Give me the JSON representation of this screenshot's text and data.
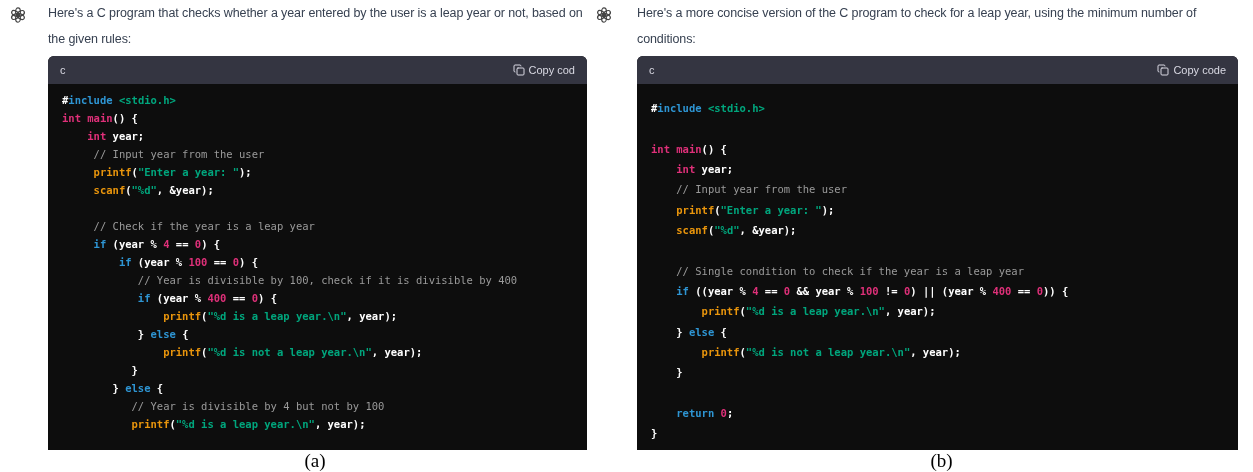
{
  "panels": [
    {
      "message": "Here's a C program that checks whether a year entered by the user is a leap year or not, based on the given rules:",
      "code_block": {
        "language": "c",
        "copy_label": "Copy cod",
        "lines": [
          {
            "kind": "code",
            "tokens": [
              {
                "kind": "plain",
                "text": "#"
              },
              {
                "kind": "keyword",
                "text": "include"
              },
              {
                "kind": "string",
                "text": " <stdio.h>"
              }
            ]
          },
          {
            "kind": "code",
            "tokens": [
              {
                "kind": "type",
                "text": "int"
              },
              {
                "kind": "type",
                "text": " main"
              },
              {
                "kind": "plain",
                "text": "() {"
              }
            ]
          },
          {
            "kind": "code",
            "tokens": [
              {
                "kind": "type",
                "text": "    int"
              },
              {
                "kind": "plain",
                "text": " year;"
              }
            ]
          },
          {
            "kind": "code",
            "tokens": [
              {
                "kind": "comment",
                "text": "     // Input year from the user"
              }
            ]
          },
          {
            "kind": "code",
            "tokens": [
              {
                "kind": "function",
                "text": "     printf"
              },
              {
                "kind": "plain",
                "text": "("
              },
              {
                "kind": "string",
                "text": "\"Enter a year: \""
              },
              {
                "kind": "plain",
                "text": ");"
              }
            ]
          },
          {
            "kind": "code",
            "tokens": [
              {
                "kind": "function",
                "text": "     scanf"
              },
              {
                "kind": "plain",
                "text": "("
              },
              {
                "kind": "string",
                "text": "\"%d\""
              },
              {
                "kind": "plain",
                "text": ", &year);"
              }
            ]
          },
          {
            "kind": "blank"
          },
          {
            "kind": "code",
            "tokens": [
              {
                "kind": "comment",
                "text": "     // Check if the year is a leap year"
              }
            ]
          },
          {
            "kind": "code",
            "tokens": [
              {
                "kind": "keyword",
                "text": "     if"
              },
              {
                "kind": "plain",
                "text": " (year % "
              },
              {
                "kind": "number",
                "text": "4"
              },
              {
                "kind": "plain",
                "text": " == "
              },
              {
                "kind": "number",
                "text": "0"
              },
              {
                "kind": "plain",
                "text": ") {"
              }
            ]
          },
          {
            "kind": "code",
            "tokens": [
              {
                "kind": "keyword",
                "text": "         if"
              },
              {
                "kind": "plain",
                "text": " (year % "
              },
              {
                "kind": "number",
                "text": "100"
              },
              {
                "kind": "plain",
                "text": " == "
              },
              {
                "kind": "number",
                "text": "0"
              },
              {
                "kind": "plain",
                "text": ") {"
              }
            ]
          },
          {
            "kind": "code",
            "tokens": [
              {
                "kind": "comment",
                "text": "            // Year is divisible by 100, check if it is divisible by 400"
              }
            ]
          },
          {
            "kind": "code",
            "tokens": [
              {
                "kind": "keyword",
                "text": "            if"
              },
              {
                "kind": "plain",
                "text": " (year % "
              },
              {
                "kind": "number",
                "text": "400"
              },
              {
                "kind": "plain",
                "text": " == "
              },
              {
                "kind": "number",
                "text": "0"
              },
              {
                "kind": "plain",
                "text": ") {"
              }
            ]
          },
          {
            "kind": "code",
            "tokens": [
              {
                "kind": "function",
                "text": "                printf"
              },
              {
                "kind": "plain",
                "text": "("
              },
              {
                "kind": "string",
                "text": "\"%d is a leap year.\\n\""
              },
              {
                "kind": "plain",
                "text": ", year);"
              }
            ]
          },
          {
            "kind": "code",
            "tokens": [
              {
                "kind": "plain",
                "text": "            } "
              },
              {
                "kind": "keyword",
                "text": "else"
              },
              {
                "kind": "plain",
                "text": " {"
              }
            ]
          },
          {
            "kind": "code",
            "tokens": [
              {
                "kind": "function",
                "text": "                printf"
              },
              {
                "kind": "plain",
                "text": "("
              },
              {
                "kind": "string",
                "text": "\"%d is not a leap year.\\n\""
              },
              {
                "kind": "plain",
                "text": ", year);"
              }
            ]
          },
          {
            "kind": "code",
            "tokens": [
              {
                "kind": "plain",
                "text": "           }"
              }
            ]
          },
          {
            "kind": "code",
            "tokens": [
              {
                "kind": "plain",
                "text": "        } "
              },
              {
                "kind": "keyword",
                "text": "else"
              },
              {
                "kind": "plain",
                "text": " {"
              }
            ]
          },
          {
            "kind": "code",
            "tokens": [
              {
                "kind": "comment",
                "text": "           // Year is divisible by 4 but not by 100"
              }
            ]
          },
          {
            "kind": "code",
            "tokens": [
              {
                "kind": "function",
                "text": "           printf"
              },
              {
                "kind": "plain",
                "text": "("
              },
              {
                "kind": "string",
                "text": "\"%d is a leap year.\\n\""
              },
              {
                "kind": "plain",
                "text": ", year);"
              }
            ]
          }
        ]
      },
      "caption": "(a)"
    },
    {
      "message": "Here's a more concise version of the C program to check for a leap year, using the minimum number of conditions:",
      "code_block": {
        "language": "c",
        "copy_label": "Copy code",
        "lines": [
          {
            "kind": "code",
            "tokens": [
              {
                "kind": "plain",
                "text": "#"
              },
              {
                "kind": "keyword",
                "text": "include"
              },
              {
                "kind": "string",
                "text": " <stdio.h>"
              }
            ]
          },
          {
            "kind": "blank"
          },
          {
            "kind": "code",
            "tokens": [
              {
                "kind": "type",
                "text": "int"
              },
              {
                "kind": "type",
                "text": " main"
              },
              {
                "kind": "plain",
                "text": "() {"
              }
            ]
          },
          {
            "kind": "code",
            "tokens": [
              {
                "kind": "type",
                "text": "    int"
              },
              {
                "kind": "plain",
                "text": " year;"
              }
            ]
          },
          {
            "kind": "code",
            "tokens": [
              {
                "kind": "comment",
                "text": "    // Input year from the user"
              }
            ]
          },
          {
            "kind": "code",
            "tokens": [
              {
                "kind": "function",
                "text": "    printf"
              },
              {
                "kind": "plain",
                "text": "("
              },
              {
                "kind": "string",
                "text": "\"Enter a year: \""
              },
              {
                "kind": "plain",
                "text": ");"
              }
            ]
          },
          {
            "kind": "code",
            "tokens": [
              {
                "kind": "function",
                "text": "    scanf"
              },
              {
                "kind": "plain",
                "text": "("
              },
              {
                "kind": "string",
                "text": "\"%d\""
              },
              {
                "kind": "plain",
                "text": ", &year);"
              }
            ]
          },
          {
            "kind": "blank"
          },
          {
            "kind": "code",
            "tokens": [
              {
                "kind": "comment",
                "text": "    // Single condition to check if the year is a leap year"
              }
            ]
          },
          {
            "kind": "code",
            "tokens": [
              {
                "kind": "keyword",
                "text": "    if"
              },
              {
                "kind": "plain",
                "text": " ((year % "
              },
              {
                "kind": "number",
                "text": "4"
              },
              {
                "kind": "plain",
                "text": " == "
              },
              {
                "kind": "number",
                "text": "0"
              },
              {
                "kind": "plain",
                "text": " && year % "
              },
              {
                "kind": "number",
                "text": "100"
              },
              {
                "kind": "plain",
                "text": " != "
              },
              {
                "kind": "number",
                "text": "0"
              },
              {
                "kind": "plain",
                "text": ") || (year % "
              },
              {
                "kind": "number",
                "text": "400"
              },
              {
                "kind": "plain",
                "text": " == "
              },
              {
                "kind": "number",
                "text": "0"
              },
              {
                "kind": "plain",
                "text": ")) {"
              }
            ]
          },
          {
            "kind": "code",
            "tokens": [
              {
                "kind": "function",
                "text": "        printf"
              },
              {
                "kind": "plain",
                "text": "("
              },
              {
                "kind": "string",
                "text": "\"%d is a leap year.\\n\""
              },
              {
                "kind": "plain",
                "text": ", year);"
              }
            ]
          },
          {
            "kind": "code",
            "tokens": [
              {
                "kind": "plain",
                "text": "    } "
              },
              {
                "kind": "keyword",
                "text": "else"
              },
              {
                "kind": "plain",
                "text": " {"
              }
            ]
          },
          {
            "kind": "code",
            "tokens": [
              {
                "kind": "function",
                "text": "        printf"
              },
              {
                "kind": "plain",
                "text": "("
              },
              {
                "kind": "string",
                "text": "\"%d is not a leap year.\\n\""
              },
              {
                "kind": "plain",
                "text": ", year);"
              }
            ]
          },
          {
            "kind": "code",
            "tokens": [
              {
                "kind": "plain",
                "text": "    }"
              }
            ]
          },
          {
            "kind": "blank"
          },
          {
            "kind": "code",
            "tokens": [
              {
                "kind": "keyword",
                "text": "    return"
              },
              {
                "kind": "number",
                "text": " 0"
              },
              {
                "kind": "plain",
                "text": ";"
              }
            ]
          },
          {
            "kind": "code",
            "tokens": [
              {
                "kind": "plain",
                "text": "}"
              }
            ]
          }
        ]
      },
      "caption": "(b)"
    }
  ]
}
